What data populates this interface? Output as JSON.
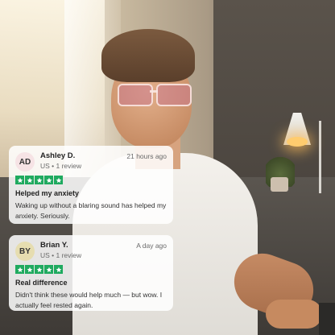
{
  "colors": {
    "star_green": "#1faa5f",
    "avatar_1": "#f6e3e5",
    "avatar_2": "#e6ddb0"
  },
  "reviews": [
    {
      "initials": "AD",
      "name": "Ashley D.",
      "meta": "US • 1 review",
      "time": "21 hours ago",
      "rating": 5,
      "title": "Helped my anxiety",
      "body": "Waking up without a blaring sound has helped my anxiety. Seriously."
    },
    {
      "initials": "BY",
      "name": "Brian Y.",
      "meta": "US • 1 review",
      "time": "A day ago",
      "rating": 5,
      "title": "Real difference",
      "body": "Didn't think these would help much — but wow. I actually feel rested again."
    }
  ]
}
